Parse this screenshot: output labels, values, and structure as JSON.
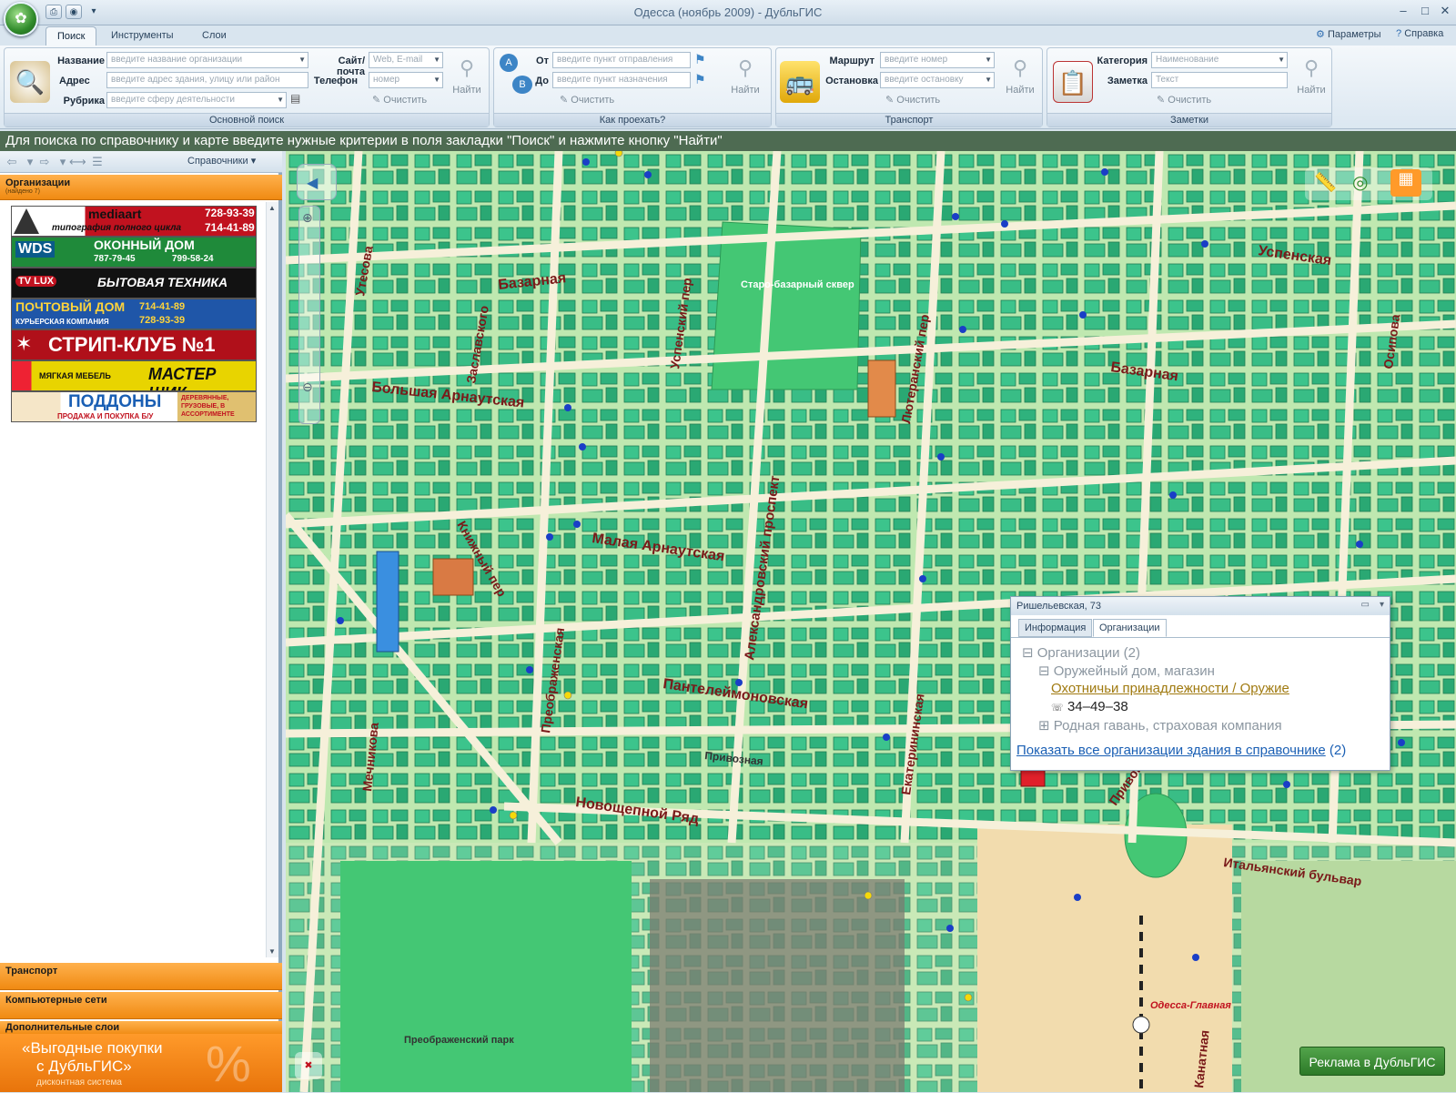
{
  "window": {
    "title": "Одесса (ноябрь 2009) - ДубльГИС",
    "orb_glyph": "✿"
  },
  "tabs": [
    "Поиск",
    "Инструменты",
    "Слои"
  ],
  "top_links": {
    "params": "Параметры",
    "help": "Справка"
  },
  "ribbon": {
    "main_search": {
      "caption": "Основной поиск",
      "name_label": "Название",
      "name_placeholder": "введите название организации",
      "address_label": "Адрес",
      "address_placeholder": "введите адрес здания, улицу или район",
      "rubric_label": "Рубрика",
      "rubric_placeholder": "введите сферу деятельности",
      "site_label": "Сайт/почта",
      "site_placeholder": "Web, E-mail",
      "phone_label": "Телефон",
      "phone_placeholder": "номер",
      "clear_label": "Очистить",
      "find_label": "Найти"
    },
    "route": {
      "caption": "Как проехать?",
      "from_label": "От",
      "from_placeholder": "введите пункт отправления",
      "to_label": "До",
      "to_placeholder": "введите пункт назначения",
      "clear_label": "Очистить",
      "find_label": "Найти"
    },
    "transport": {
      "caption": "Транспорт",
      "route_label": "Маршрут",
      "route_placeholder": "введите номер",
      "stop_label": "Остановка",
      "stop_placeholder": "введите остановку",
      "clear_label": "Очистить",
      "find_label": "Найти"
    },
    "notes": {
      "caption": "Заметки",
      "category_label": "Категория",
      "category_placeholder": "Наименование",
      "note_label": "Заметка",
      "note_placeholder": "Текст",
      "clear_label": "Очистить",
      "find_label": "Найти"
    }
  },
  "hint": "Для поиска по справочнику и карте введите нужные критерии в поля закладки \"Поиск\" и нажмите кнопку \"Найти\"",
  "left_panel": {
    "directories_label": "Справочники",
    "organizations": {
      "title": "Организации",
      "subtitle": "(найдено 7)"
    },
    "banners": [
      {
        "name": "mediaart",
        "left_text": "mediaart",
        "line2": "типография полного цикла",
        "phone1": "728-93-39",
        "phone2": "714-41-89"
      },
      {
        "name": "wds",
        "brand": "WDS",
        "title": "ОКОННЫЙ ДОМ",
        "phone1": "787-79-45",
        "phone2": "799-58-24"
      },
      {
        "name": "tvlux",
        "brand": "TV LUX",
        "title": "БЫТОВАЯ ТЕХНИКА"
      },
      {
        "name": "pochtovy",
        "title": "ПОЧТОВЫЙ ДОМ",
        "sub": "КУРЬЕРСКАЯ КОМПАНИЯ",
        "phone1": "714-41-89",
        "phone2": "728-93-39"
      },
      {
        "name": "stripclub",
        "title": "СТРИП-КЛУБ №1"
      },
      {
        "name": "masterwik",
        "left": "МЯГКАЯ МЕБЕЛЬ",
        "title": "МАСТЕР ШИК"
      },
      {
        "name": "poddony",
        "title": "ПОДДОНЫ",
        "sub": "ПРОДАЖА И ПОКУПКА Б/У",
        "right": "ДЕРЕВЯННЫЕ, ГРУЗОВЫЕ, В АССОРТИМЕНТЕ"
      }
    ],
    "sections": [
      {
        "title": "Транспорт"
      },
      {
        "title": "Компьютерные сети"
      },
      {
        "title": "Дополнительные слои"
      }
    ],
    "promo": {
      "line1": "«Выгодные покупки",
      "line2": "с ДубльГИС»",
      "line3": "дисконтная система",
      "glyph": "%"
    }
  },
  "map": {
    "streets": [
      {
        "name": "Утесова"
      },
      {
        "name": "Базарная"
      },
      {
        "name": "Заславского"
      },
      {
        "name": "Большая Арнаутская"
      },
      {
        "name": "Успенский пер"
      },
      {
        "name": "Старо-базарный сквер"
      },
      {
        "name": "Лютеранский пер"
      },
      {
        "name": "Базарная"
      },
      {
        "name": "Успенская"
      },
      {
        "name": "Осипова"
      },
      {
        "name": "Александровский проспект"
      },
      {
        "name": "Малая Арнаутская"
      },
      {
        "name": "Книжный пер"
      },
      {
        "name": "Преображенская"
      },
      {
        "name": "Пантелеймоновская"
      },
      {
        "name": "Привозная"
      },
      {
        "name": "Новощепной Ряд"
      },
      {
        "name": "Мечникова"
      },
      {
        "name": "Екатерининская"
      },
      {
        "name": "Привокзальная площадь"
      },
      {
        "name": "Итальянский бульвар"
      },
      {
        "name": "Преображенский парк"
      },
      {
        "name": "Одесса-Главная"
      },
      {
        "name": "Канатная"
      }
    ],
    "popup": {
      "title": "Ришельевская, 73",
      "tab_info": "Информация",
      "tab_orgs": "Организации",
      "root": "Организации (2)",
      "org1": "Оружейный дом, магазин",
      "org1_rubric": "Охотничьи принадлежности / Оружие",
      "org1_phone": "34–49–38",
      "org2": "Родная гавань, страховая компания",
      "show_all": "Показать все организации здания в справочнике",
      "show_all_count": "(2)"
    },
    "ad_button": "Реклама в ДубльГИС"
  }
}
